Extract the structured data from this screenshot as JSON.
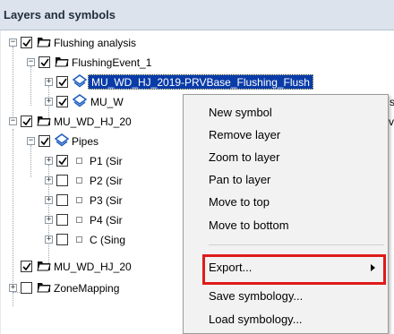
{
  "panel": {
    "title": "Layers and symbols"
  },
  "tree": {
    "flushing_analysis": "Flushing analysis",
    "flushing_event": "FlushingEvent_1",
    "layer_selected": "MU_WD_HJ_2019-PRVBase_Flushing_Flush",
    "layer_second_prefix": "MU_W",
    "layer_second_tail": "sh",
    "group_mu": "MU_WD_HJ_20",
    "group_mu_tail": "v",
    "pipes": "Pipes",
    "items": [
      {
        "label": "P1 (Sir",
        "checked": true
      },
      {
        "label": "P2 (Sir",
        "checked": false
      },
      {
        "label": "P3 (Sir",
        "checked": false
      },
      {
        "label": "P4 (Sir",
        "checked": false
      },
      {
        "label": "C (Sing",
        "checked": false
      }
    ],
    "group_mu2": "MU_WD_HJ_20",
    "zone_mapping": "ZoneMapping"
  },
  "context_menu": {
    "new_symbol": "New symbol",
    "remove_layer": "Remove layer",
    "zoom_to_layer": "Zoom to layer",
    "pan_to_layer": "Pan to layer",
    "move_to_top": "Move to top",
    "move_to_bottom": "Move to bottom",
    "export": "Export...",
    "save_symbology": "Save symbology...",
    "load_symbology": "Load symbology..."
  },
  "colors": {
    "selection": "#0a3ca8",
    "highlight": "#e01a1a",
    "header_bg": "#dce3ec"
  }
}
